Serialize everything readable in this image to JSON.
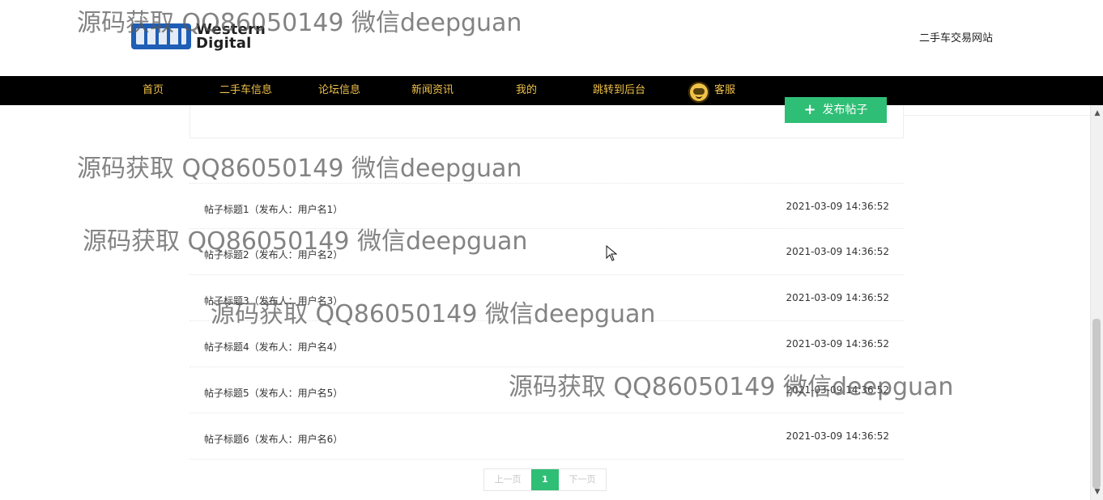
{
  "header": {
    "logo": {
      "line1": "Western",
      "line2": "Digital"
    },
    "site_name": "二手车交易网站"
  },
  "nav": {
    "items": [
      {
        "label": "首页"
      },
      {
        "label": "二手车信息"
      },
      {
        "label": "论坛信息"
      },
      {
        "label": "新闻资讯"
      },
      {
        "label": "我的"
      },
      {
        "label": "跳转到后台"
      },
      {
        "label": "客服",
        "icon": "customer-service-icon"
      }
    ]
  },
  "actions": {
    "publish_label": "发布帖子",
    "publish_icon": "plus-icon"
  },
  "posts": [
    {
      "title": "帖子标题1（发布人：用户名1）",
      "date": "2021-03-09 14:36:52"
    },
    {
      "title": "帖子标题2（发布人：用户名2）",
      "date": "2021-03-09 14:36:52"
    },
    {
      "title": "帖子标题3（发布人：用户名3）",
      "date": "2021-03-09 14:36:52"
    },
    {
      "title": "帖子标题4（发布人：用户名4）",
      "date": "2021-03-09 14:36:52"
    },
    {
      "title": "帖子标题5（发布人：用户名5）",
      "date": "2021-03-09 14:36:52"
    },
    {
      "title": "帖子标题6（发布人：用户名6）",
      "date": "2021-03-09 14:36:52"
    }
  ],
  "pagination": {
    "prev": "上一页",
    "current": "1",
    "next": "下一页"
  },
  "watermarks": [
    "源码获取 QQ86050149 微信deepguan",
    "源码获取 QQ86050149 微信deepguan",
    "源码获取 QQ86050149 微信deepguan",
    "源码获取 QQ86050149 微信deepguan",
    "源码获取 QQ86050149 微信deepguan"
  ],
  "colors": {
    "nav_bg": "#000000",
    "nav_text": "#f0c24a",
    "accent_green": "#2fbe75"
  }
}
